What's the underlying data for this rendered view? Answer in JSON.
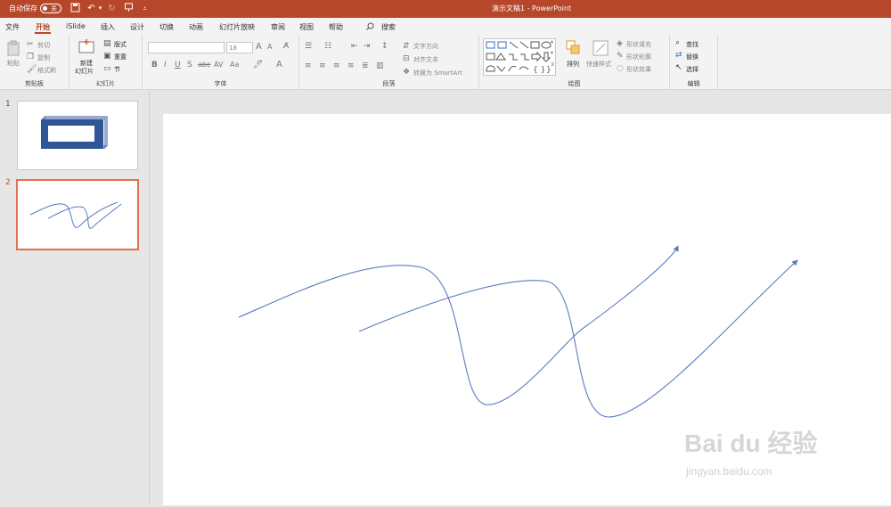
{
  "titlebar": {
    "autosave": "自动保存",
    "autosave_state": "关",
    "document_title": "演示文稿1  -  PowerPoint"
  },
  "menu": [
    "文件",
    "开始",
    "iSlide",
    "插入",
    "设计",
    "切换",
    "动画",
    "幻灯片放映",
    "审阅",
    "视图",
    "帮助",
    "搜索"
  ],
  "ribbon": {
    "clipboard": {
      "paste": "粘贴",
      "cut": "剪切",
      "copy": "复制",
      "format_painter": "格式刷",
      "label": "剪贴板"
    },
    "slides": {
      "new_slide_1": "新建",
      "new_slide_2": "幻灯片",
      "layout": "版式",
      "reset": "重置",
      "section": "节",
      "label": "幻灯片"
    },
    "font": {
      "size": "18",
      "label": "字体"
    },
    "paragraph": {
      "text_direction": "文字方向",
      "align_text": "对齐文本",
      "smartart": "转换为 SmartArt",
      "label": "段落"
    },
    "drawing": {
      "arrange": "排列",
      "quick_styles": "快速样式",
      "shape_fill": "形状填充",
      "shape_outline": "形状轮廓",
      "shape_effects": "形状效果",
      "label": "绘图"
    },
    "editing": {
      "find": "查找",
      "replace": "替换",
      "select": "选择",
      "label": "编辑"
    }
  },
  "slides": [
    {
      "number": "1"
    },
    {
      "number": "2"
    }
  ],
  "colors": {
    "accent": "#b7472a",
    "line": "#5a7cbf",
    "selection": "#e4704f"
  },
  "watermark": {
    "brand": "Bai du 经验",
    "url": "jingyan.baidu.com"
  }
}
